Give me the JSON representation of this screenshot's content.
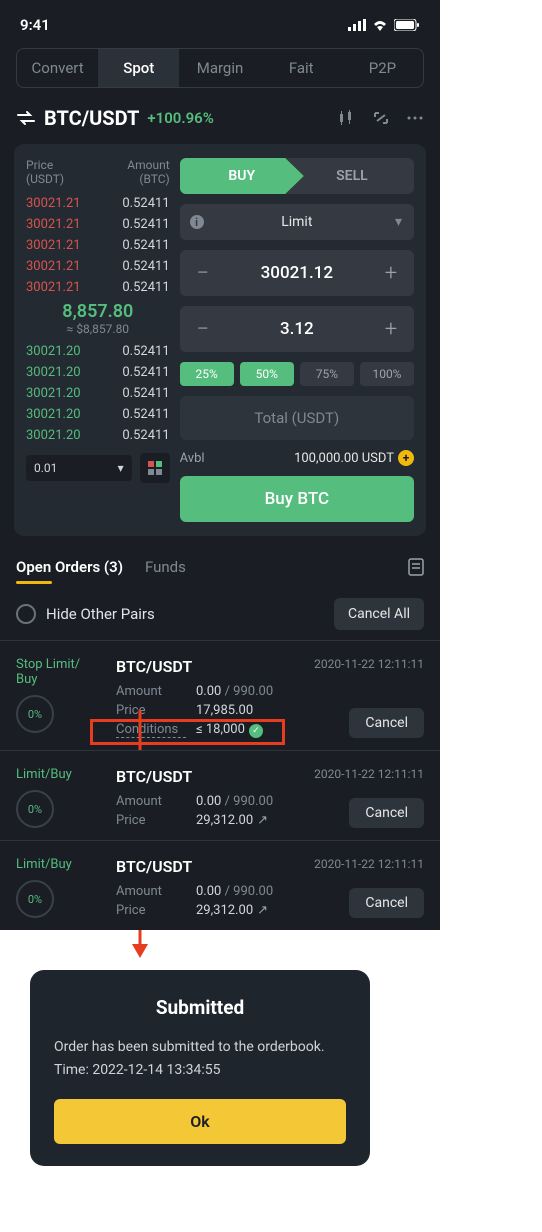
{
  "status": {
    "time": "9:41"
  },
  "nav": {
    "tabs": [
      "Convert",
      "Spot",
      "Margin",
      "Fait",
      "P2P"
    ],
    "active": 1
  },
  "pair": {
    "symbol": "BTC/USDT",
    "change": "+100.96%"
  },
  "orderbook": {
    "head_price": "Price",
    "head_price_unit": "(USDT)",
    "head_amount": "Amount",
    "head_amount_unit": "(BTC)",
    "asks": [
      {
        "p": "30021.21",
        "a": "0.52411"
      },
      {
        "p": "30021.21",
        "a": "0.52411"
      },
      {
        "p": "30021.21",
        "a": "0.52411"
      },
      {
        "p": "30021.21",
        "a": "0.52411"
      },
      {
        "p": "30021.21",
        "a": "0.52411"
      }
    ],
    "mid_price": "8,857.80",
    "mid_approx": "≈ $8,857.80",
    "bids": [
      {
        "p": "30021.20",
        "a": "0.52411"
      },
      {
        "p": "30021.20",
        "a": "0.52411"
      },
      {
        "p": "30021.20",
        "a": "0.52411"
      },
      {
        "p": "30021.20",
        "a": "0.52411"
      },
      {
        "p": "30021.20",
        "a": "0.52411"
      }
    ],
    "depth": "0.01"
  },
  "trade": {
    "buy_label": "BUY",
    "sell_label": "SELL",
    "order_type": "Limit",
    "price": "30021.12",
    "amount": "3.12",
    "pct": [
      "25%",
      "50%",
      "75%",
      "100%"
    ],
    "total_placeholder": "Total (USDT)",
    "avbl_label": "Avbl",
    "avbl_value": "100,000.00 USDT",
    "submit": "Buy BTC"
  },
  "orders_header": {
    "tab_open": "Open Orders (3)",
    "tab_funds": "Funds",
    "hide_label": "Hide Other Pairs",
    "cancel_all": "Cancel All"
  },
  "orders": [
    {
      "side": "Stop Limit/\nBuy",
      "progress": "0%",
      "pair": "BTC/USDT",
      "time": "2020-11-22  12:11:11",
      "lines": [
        {
          "label": "Amount",
          "val": "0.00",
          "suf": " / 990.00"
        },
        {
          "label": "Price",
          "val": "17,985.00",
          "suf": ""
        },
        {
          "label": "Conditions",
          "val": "≤ 18,000",
          "suf": "",
          "check": true
        }
      ],
      "cancel": "Cancel",
      "highlight": true
    },
    {
      "side": "Limit/Buy",
      "progress": "0%",
      "pair": "BTC/USDT",
      "time": "2020-11-22  12:11:11",
      "lines": [
        {
          "label": "Amount",
          "val": "0.00",
          "suf": " / 990.00"
        },
        {
          "label": "Price",
          "val": "29,312.00",
          "suf": "",
          "share": true
        }
      ],
      "cancel": "Cancel"
    },
    {
      "side": "Limit/Buy",
      "progress": "0%",
      "pair": "BTC/USDT",
      "time": "2020-11-22  12:11:11",
      "lines": [
        {
          "label": "Amount",
          "val": "0.00",
          "suf": " / 990.00"
        },
        {
          "label": "Price",
          "val": "29,312.00",
          "suf": "",
          "share": true
        }
      ],
      "cancel": "Cancel"
    }
  ],
  "modal": {
    "title": "Submitted",
    "body": "Order has been submitted to the orderbook.",
    "time": "Time: 2022-12-14 13:34:55",
    "ok": "Ok"
  }
}
